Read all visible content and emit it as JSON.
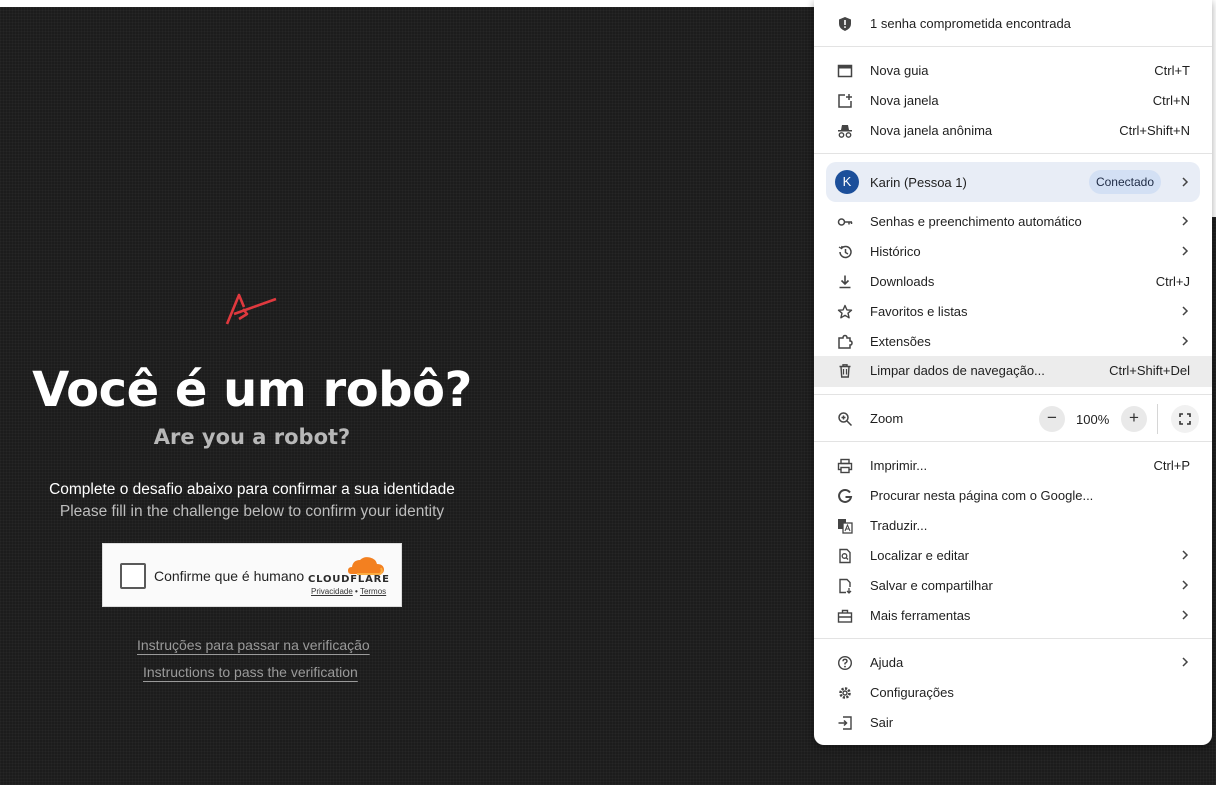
{
  "page": {
    "title_pt": "Você é um robô?",
    "title_en": "Are you a robot?",
    "desc_pt": "Complete o desafio abaixo para confirmar a sua identidade",
    "desc_en": "Please fill in the challenge below to confirm your identity",
    "captcha": {
      "label": "Confirme que é humano",
      "brand": "CLOUDFLARE",
      "privacy": "Privacidade",
      "separator": "•",
      "terms": "Termos"
    },
    "link_pt": "Instruções para passar na verificação",
    "link_en": "Instructions to pass the verification",
    "colors": {
      "logo": "#e0393e",
      "cloudflare_orange": "#f38020",
      "background": "#1c1c1c"
    }
  },
  "menu": {
    "alert": {
      "label": "1 senha comprometida encontrada",
      "icon": "shield-alert-icon"
    },
    "new_tab": {
      "label": "Nova guia",
      "shortcut": "Ctrl+T",
      "icon": "new-tab-icon"
    },
    "new_window": {
      "label": "Nova janela",
      "shortcut": "Ctrl+N",
      "icon": "new-window-icon"
    },
    "incognito": {
      "label": "Nova janela anônima",
      "shortcut": "Ctrl+Shift+N",
      "icon": "incognito-icon"
    },
    "profile": {
      "initial": "K",
      "name": "Karin (Pessoa 1)",
      "status": "Conectado",
      "avatar_color": "#1c4f9a"
    },
    "passwords": {
      "label": "Senhas e preenchimento automático",
      "icon": "key-icon"
    },
    "history": {
      "label": "Histórico",
      "icon": "history-icon"
    },
    "downloads": {
      "label": "Downloads",
      "shortcut": "Ctrl+J",
      "icon": "download-icon"
    },
    "bookmarks": {
      "label": "Favoritos e listas",
      "icon": "star-icon"
    },
    "extensions": {
      "label": "Extensões",
      "icon": "puzzle-icon"
    },
    "clear_data": {
      "label": "Limpar dados de navegação...",
      "shortcut": "Ctrl+Shift+Del",
      "icon": "trash-icon"
    },
    "zoom": {
      "label": "Zoom",
      "minus": "−",
      "value": "100%",
      "plus": "+",
      "icon": "zoom-icon"
    },
    "print": {
      "label": "Imprimir...",
      "shortcut": "Ctrl+P",
      "icon": "print-icon"
    },
    "google_search": {
      "label": "Procurar nesta página com o Google...",
      "icon": "google-icon"
    },
    "translate": {
      "label": "Traduzir...",
      "icon": "translate-icon"
    },
    "find_edit": {
      "label": "Localizar e editar",
      "icon": "find-page-icon"
    },
    "save_share": {
      "label": "Salvar e compartilhar",
      "icon": "save-share-icon"
    },
    "more_tools": {
      "label": "Mais ferramentas",
      "icon": "toolbox-icon"
    },
    "help": {
      "label": "Ajuda",
      "icon": "help-icon"
    },
    "settings": {
      "label": "Configurações",
      "icon": "gear-icon"
    },
    "exit": {
      "label": "Sair",
      "icon": "exit-icon"
    }
  }
}
